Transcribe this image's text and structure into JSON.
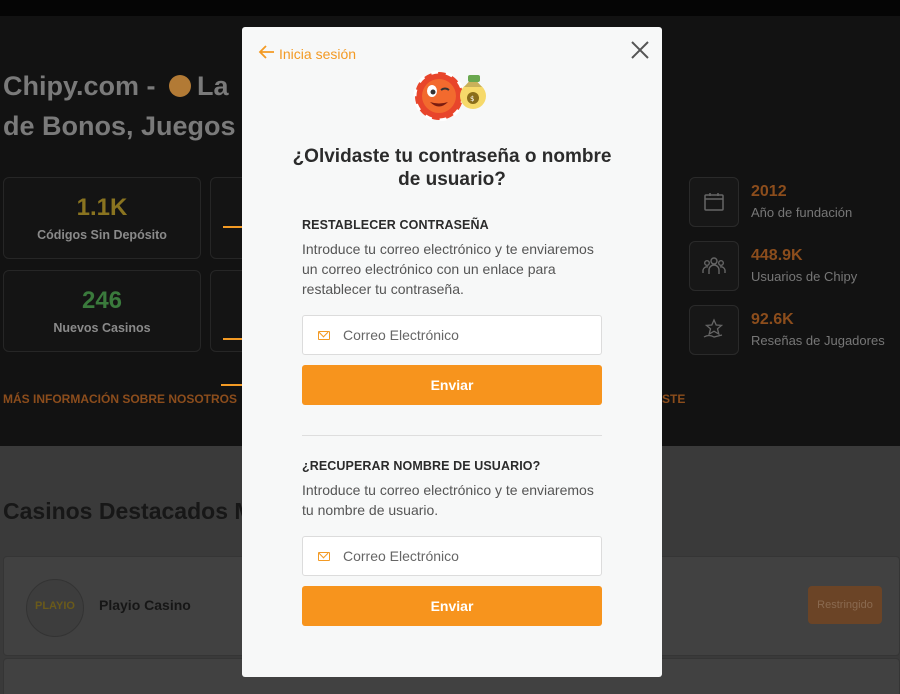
{
  "background": {
    "hero_title_part1": "Chipy.com - ",
    "hero_title_part2": "La",
    "hero_title_line2": "de Bonos, Juegos y",
    "stats": [
      {
        "value": "1.1K",
        "label": "Códigos Sin Depósito",
        "color": "#c9a227"
      },
      {
        "value": "246",
        "label": "Nuevos Casinos",
        "color": "#4caf50"
      }
    ],
    "right_stats": [
      {
        "value": "2012",
        "label": "Año de fundación",
        "icon": "calendar-icon"
      },
      {
        "value": "448.9K",
        "label": "Usuarios de Chipy",
        "icon": "users-icon"
      },
      {
        "value": "92.6K",
        "label": "Reseñas de Jugadores",
        "icon": "star-hand-icon"
      }
    ],
    "more_info_link": "MÁS INFORMACIÓN SOBRE NOSOTROS",
    "more_info_link_right": "STE",
    "section_title": "Casinos Destacados M",
    "casino": {
      "logo_text": "PLAYIO",
      "name": "Playio Casino",
      "status": "Restringido"
    }
  },
  "modal": {
    "back_label": "Inicia sesión",
    "title": "¿Olvidaste tu contraseña o nombre de usuario?",
    "reset_password": {
      "heading": "RESTABLECER CONTRASEÑA",
      "description": "Introduce tu correo electrónico y te enviaremos un correo electrónico con un enlace para restablecer tu contraseña.",
      "email_placeholder": "Correo Electrónico",
      "submit_label": "Enviar"
    },
    "recover_username": {
      "heading": "¿RECUPERAR NOMBRE DE USUARIO?",
      "description": "Introduce tu correo electrónico y te enviaremos tu nombre de usuario.",
      "email_placeholder": "Correo Electrónico",
      "submit_label": "Enviar"
    }
  },
  "colors": {
    "accent": "#f7941d",
    "modal_bg": "#f7f8f8"
  }
}
